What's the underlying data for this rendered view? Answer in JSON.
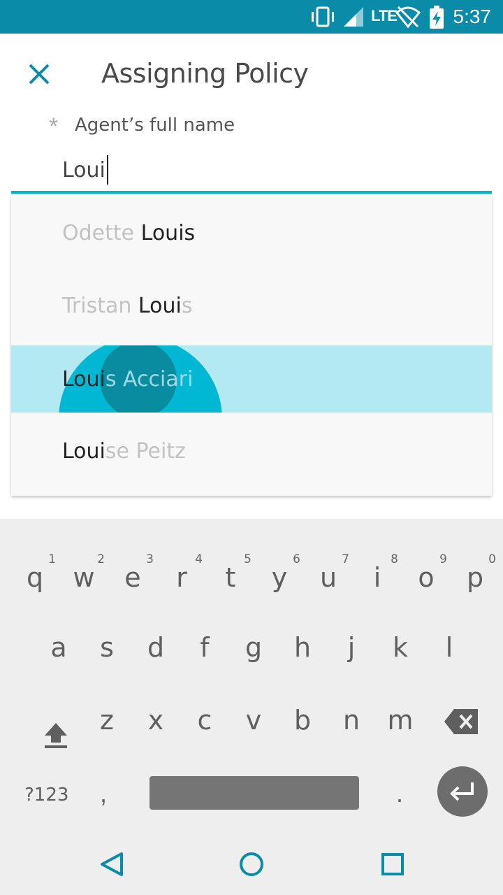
{
  "status_bar": {
    "time": "5:37",
    "network": "LTE",
    "icons": [
      "vibrate-icon",
      "signal-icon",
      "wifi-off-icon",
      "battery-charging-icon"
    ]
  },
  "header": {
    "title": "Assigning Policy",
    "close_icon": "close-icon"
  },
  "form": {
    "required_marker": "*",
    "label": "Agent’s full name",
    "value": "Loui"
  },
  "suggestions": [
    {
      "before": "Odette ",
      "match": "Louis",
      "after": ""
    },
    {
      "before": "Tristan ",
      "match": "Loui",
      "after": "s"
    },
    {
      "before": "",
      "match": "Loui",
      "after": "s Acciari"
    },
    {
      "before": "",
      "match": "Loui",
      "after": "se Peitz"
    }
  ],
  "keyboard": {
    "row1": [
      {
        "k": "q",
        "h": "1"
      },
      {
        "k": "w",
        "h": "2"
      },
      {
        "k": "e",
        "h": "3"
      },
      {
        "k": "r",
        "h": "4"
      },
      {
        "k": "t",
        "h": "5"
      },
      {
        "k": "y",
        "h": "6"
      },
      {
        "k": "u",
        "h": "7"
      },
      {
        "k": "i",
        "h": "8"
      },
      {
        "k": "o",
        "h": "9"
      },
      {
        "k": "p",
        "h": "0"
      }
    ],
    "row2": [
      "a",
      "s",
      "d",
      "f",
      "g",
      "h",
      "j",
      "k",
      "l"
    ],
    "row3": [
      "z",
      "x",
      "c",
      "v",
      "b",
      "n",
      "m"
    ],
    "symbols_label": "?123",
    "comma": ",",
    "period": "."
  },
  "colors": {
    "accent": "#00b4cc",
    "status_bar": "#0a8ca8",
    "highlight_row": "#b2e9f2"
  }
}
